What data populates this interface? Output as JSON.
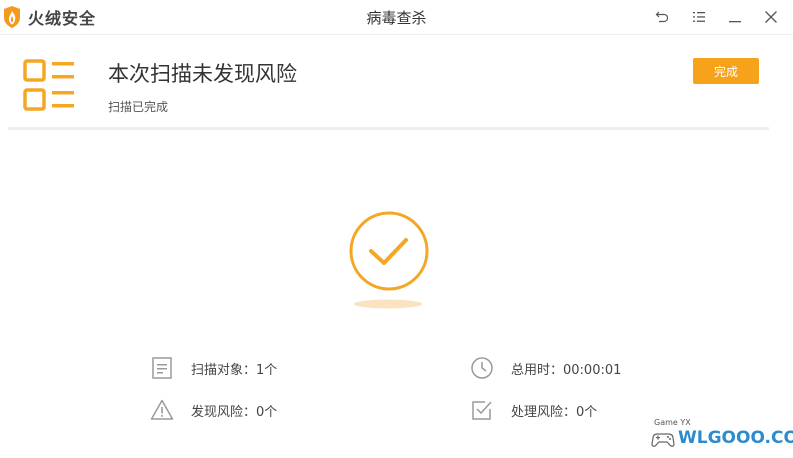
{
  "titlebar": {
    "app_name": "火绒安全",
    "window_title": "病毒查杀",
    "buttons": [
      "back-icon",
      "menu-icon",
      "minimize-icon",
      "close-icon"
    ]
  },
  "header": {
    "title": "本次扫描未发现风险",
    "subtitle": "扫描已完成",
    "done_button": "完成"
  },
  "stats": {
    "scanned": {
      "label": "扫描对象：1个",
      "icon": "document-icon"
    },
    "time_used": {
      "label": "总用时：00:00:01",
      "icon": "clock-icon"
    },
    "risks_found": {
      "label": "发现风险：0个",
      "icon": "warning-icon"
    },
    "handled": {
      "label": "处理风险：0个",
      "icon": "checkbox-icon"
    }
  },
  "watermark": {
    "text": "WLGOOO.COM",
    "small": "Game YX"
  },
  "colors": {
    "accent": "#f7a21b",
    "brand": "#f5a623",
    "text": "#333333",
    "watermark": "#2d8ccd"
  }
}
